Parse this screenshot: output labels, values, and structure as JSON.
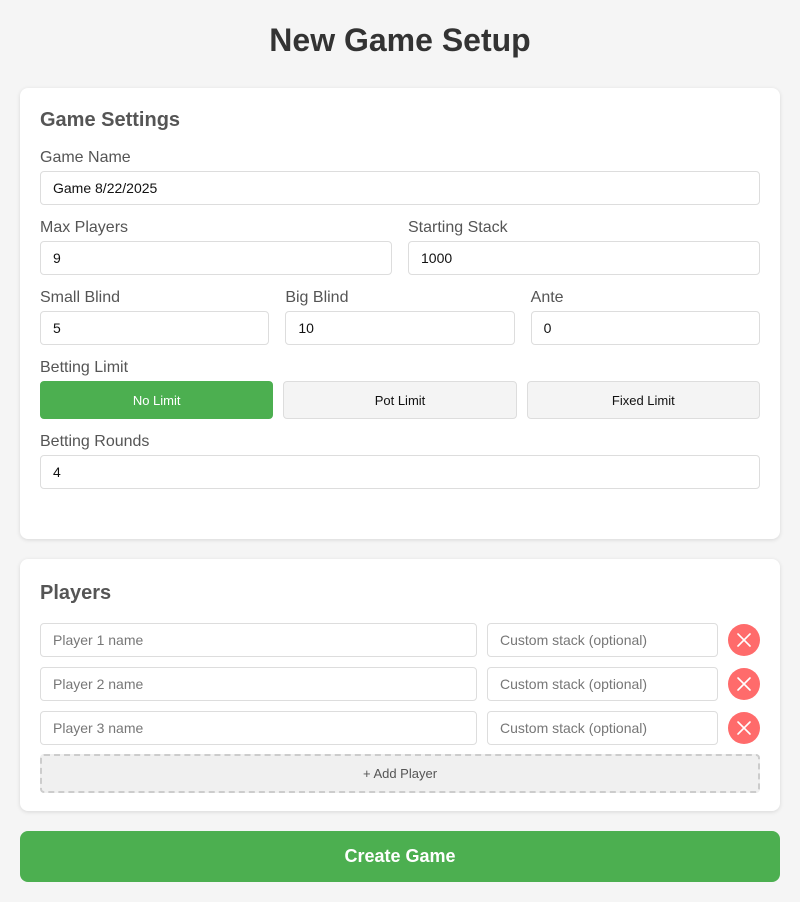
{
  "page": {
    "title": "New Game Setup"
  },
  "settings": {
    "title": "Game Settings",
    "game_name": {
      "label": "Game Name",
      "value": "Game 8/22/2025"
    },
    "max_players": {
      "label": "Max Players",
      "value": "9"
    },
    "starting_stack": {
      "label": "Starting Stack",
      "value": "1000"
    },
    "small_blind": {
      "label": "Small Blind",
      "value": "5"
    },
    "big_blind": {
      "label": "Big Blind",
      "value": "10"
    },
    "ante": {
      "label": "Ante",
      "value": "0"
    },
    "betting_limit": {
      "label": "Betting Limit",
      "options": [
        "No Limit",
        "Pot Limit",
        "Fixed Limit"
      ],
      "selected": "No Limit"
    },
    "betting_rounds": {
      "label": "Betting Rounds",
      "value": "4"
    }
  },
  "players": {
    "title": "Players",
    "rows": [
      {
        "name_placeholder": "Player 1 name",
        "stack_placeholder": "Custom stack (optional)"
      },
      {
        "name_placeholder": "Player 2 name",
        "stack_placeholder": "Custom stack (optional)"
      },
      {
        "name_placeholder": "Player 3 name",
        "stack_placeholder": "Custom stack (optional)"
      }
    ],
    "remove_icon": "close-icon",
    "add_label": "+ Add Player"
  },
  "actions": {
    "create_label": "Create Game"
  },
  "colors": {
    "accent": "#4caf50",
    "danger": "#ff6b6b",
    "background": "#f5f5f5"
  }
}
